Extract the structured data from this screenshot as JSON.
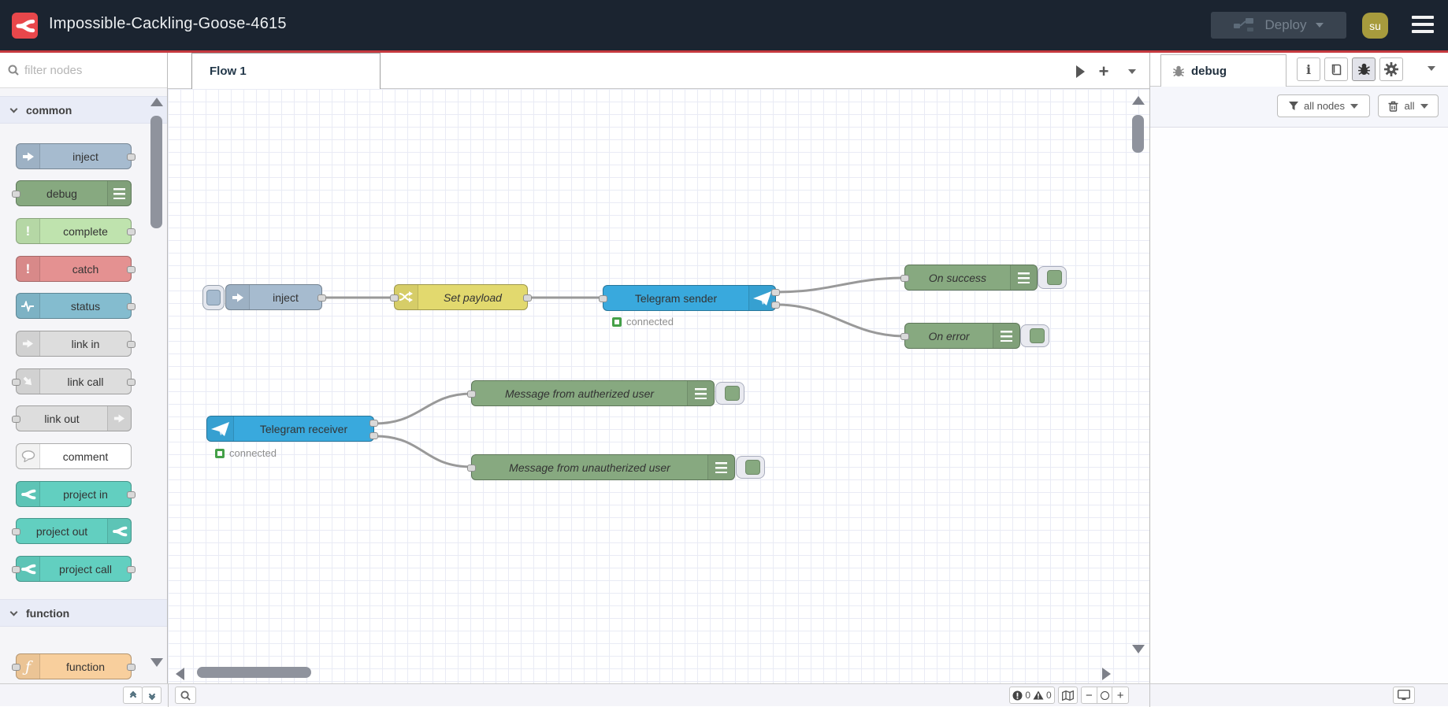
{
  "header": {
    "title": "Impossible-Cackling-Goose-4615",
    "deploy_label": "Deploy",
    "avatar_initials": "su"
  },
  "palette": {
    "filter_placeholder": "filter nodes",
    "sections": [
      {
        "label": "common"
      },
      {
        "label": "function"
      }
    ],
    "nodes": [
      {
        "label": "inject"
      },
      {
        "label": "debug"
      },
      {
        "label": "complete"
      },
      {
        "label": "catch"
      },
      {
        "label": "status"
      },
      {
        "label": "link in"
      },
      {
        "label": "link call"
      },
      {
        "label": "link out"
      },
      {
        "label": "comment"
      },
      {
        "label": "project in"
      },
      {
        "label": "project out"
      },
      {
        "label": "project call"
      },
      {
        "label": "function"
      }
    ]
  },
  "workspace": {
    "tab_label": "Flow 1"
  },
  "flow": {
    "nodes": {
      "inject": {
        "label": "inject"
      },
      "set_payload": {
        "label": "Set payload"
      },
      "telegram_sender": {
        "label": "Telegram sender",
        "status": "connected"
      },
      "on_success": {
        "label": "On success"
      },
      "on_error": {
        "label": "On error"
      },
      "telegram_receiver": {
        "label": "Telegram receiver",
        "status": "connected"
      },
      "msg_authorized": {
        "label": "Message from autherized user"
      },
      "msg_unauthorized": {
        "label": "Message from unautherized user"
      }
    }
  },
  "sidebar": {
    "tab_label": "debug",
    "filter_button": "all nodes",
    "clear_button": "all"
  },
  "footer": {
    "error_count": "0",
    "warning_count": "0"
  },
  "colors": {
    "header_bg": "#1b2430",
    "accent_red": "#c5393f",
    "logo_red": "#e8474b",
    "avatar_bg": "#a79b3d",
    "node_inject": "#a6bbcf",
    "node_debug": "#87a980",
    "node_complete": "#bfe3ae",
    "node_catch": "#e49191",
    "node_status": "#84bccf",
    "node_link": "#dddddd",
    "node_comment": "#ffffff",
    "node_project": "#62cfc0",
    "node_function": "#f8cf9d",
    "node_change": "#e2d96e",
    "node_telegram": "#39a9dd",
    "status_connected": "#44a048",
    "wire": "#999999"
  },
  "icons": {
    "logo": "node-red-curves",
    "search": "magnifier",
    "deploy": "linked-nodes",
    "menu": "hamburger",
    "debug_tab": "bug",
    "sidebar_buttons": [
      "info",
      "book",
      "bug",
      "gear"
    ],
    "filter": "funnel",
    "clear": "trash",
    "footer_left": [
      "collapse-up",
      "collapse-down",
      "magnifier"
    ],
    "footer_right": [
      "error-circle",
      "warning-triangle",
      "map",
      "zoom-out",
      "zoom-reset",
      "zoom-in",
      "monitor"
    ]
  }
}
